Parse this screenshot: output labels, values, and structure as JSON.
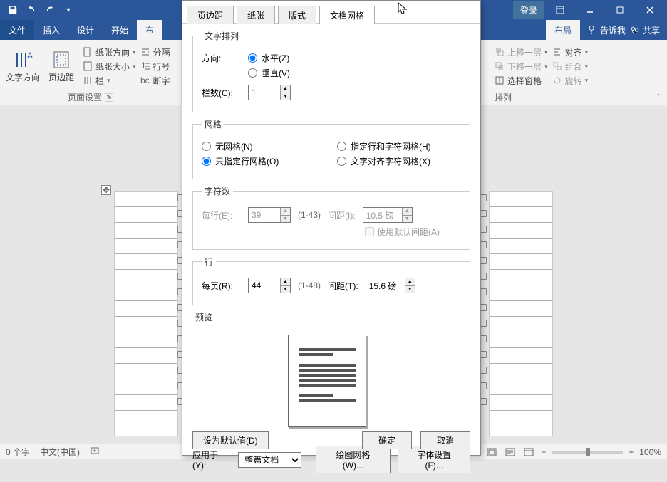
{
  "titlebar": {
    "login": "登录"
  },
  "ribbonTabs": {
    "file": "文件",
    "insert": "插入",
    "design": "设计",
    "start": "开始",
    "layoutPartial": "布",
    "layout": "布局",
    "tellme": "告诉我",
    "share": "共享"
  },
  "ribbon": {
    "textDirection": "文字方向",
    "margins": "页边距",
    "orientation": "纸张方向",
    "size": "纸张大小",
    "columns": "栏",
    "breaks": "分隔",
    "lineNumbers": "行号",
    "hyphenation": "断字",
    "pageSetupGroup": "页面设置",
    "bringForward": "上移一层",
    "sendBackward": "下移一层",
    "selectionPane": "选择窗格",
    "align": "对齐",
    "group": "组合",
    "rotate": "旋转",
    "arrangeGroup": "排列"
  },
  "dialog": {
    "tabs": {
      "margins": "页边距",
      "paper": "纸张",
      "layout": "版式",
      "grid": "文档网格"
    },
    "textArrange": {
      "legend": "文字排列",
      "direction": "方向:",
      "horizontal": "水平(Z)",
      "vertical": "垂直(V)",
      "columns": "栏数(C):",
      "columnsVal": "1"
    },
    "grid": {
      "legend": "网格",
      "none": "无网格(N)",
      "linesOnly": "只指定行网格(O)",
      "linesChars": "指定行和字符网格(H)",
      "snapChars": "文字对齐字符网格(X)"
    },
    "chars": {
      "legend": "字符数",
      "perLine": "每行(E):",
      "perLineVal": "39",
      "perLineRange": "(1-43)",
      "pitch": "间距(I):",
      "pitchVal": "10.5 磅",
      "useDefault": "使用默认间距(A)"
    },
    "lines": {
      "legend": "行",
      "perPage": "每页(R):",
      "perPageVal": "44",
      "perPageRange": "(1-48)",
      "pitch": "间距(T):",
      "pitchVal": "15.6 磅"
    },
    "preview": {
      "legend": "预览"
    },
    "applyTo": {
      "label": "应用于(Y):",
      "value": "整篇文档"
    },
    "drawingGrid": "绘图网格(W)...",
    "fontSettings": "字体设置(F)...",
    "setDefault": "设为默认值(D)",
    "ok": "确定",
    "cancel": "取消"
  },
  "status": {
    "words": "0 个字",
    "lang": "中文(中国)",
    "zoom": "100%"
  }
}
